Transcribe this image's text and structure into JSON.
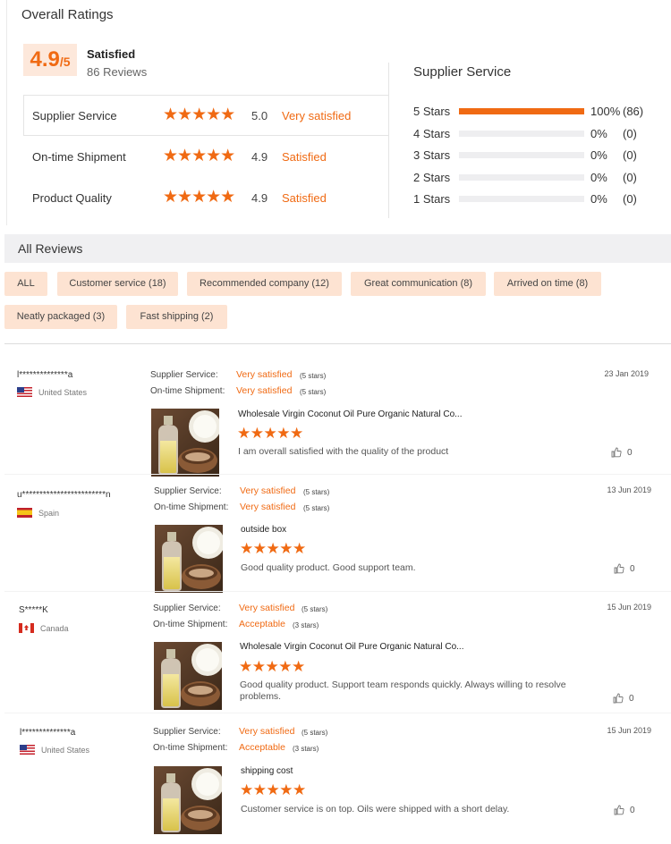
{
  "overall": {
    "title": "Overall Ratings",
    "score": "4.9",
    "score_denominator": "/5",
    "label": "Satisfied",
    "reviews": "86 Reviews"
  },
  "categories": [
    {
      "name": "Supplier Service",
      "stars": "★★★★★",
      "score": "5.0",
      "desc": "Very satisfied"
    },
    {
      "name": "On-time Shipment",
      "stars": "★★★★★",
      "score": "4.9",
      "desc": "Satisfied"
    },
    {
      "name": "Product Quality",
      "stars": "★★★★★",
      "score": "4.9",
      "desc": "Satisfied"
    }
  ],
  "supplier_service": {
    "title": "Supplier Service",
    "rows": [
      {
        "label": "5  Stars",
        "pct": "100%",
        "count": "(86)",
        "fill": 100
      },
      {
        "label": "4  Stars",
        "pct": "0%",
        "count": "(0)",
        "fill": 0
      },
      {
        "label": "3  Stars",
        "pct": "0%",
        "count": "(0)",
        "fill": 0
      },
      {
        "label": "2  Stars",
        "pct": "0%",
        "count": "(0)",
        "fill": 0
      },
      {
        "label": "1  Stars",
        "pct": "0%",
        "count": "(0)",
        "fill": 0
      }
    ]
  },
  "all_reviews": {
    "title": "All Reviews",
    "tags": [
      "ALL",
      "Customer service (18)",
      "Recommended company (12)",
      "Great communication (8)",
      "Arrived on time (8)",
      "Neatly packaged (3)",
      "Fast shipping (2)"
    ]
  },
  "reviews": [
    {
      "user": "l**************a",
      "country": "United States",
      "flag": "us",
      "date": "23 Jan 2019",
      "supplier_label": "Supplier Service:",
      "supplier_value": "Very satisfied",
      "supplier_stars": "(5 stars)",
      "shipment_label": "On-time Shipment:",
      "shipment_value": "Very satisfied",
      "shipment_stars": "(5 stars)",
      "product_title": "Wholesale Virgin Coconut Oil Pure Organic Natural Co...",
      "stars": "★★★★★",
      "comment": "I am overall satisfied with the quality of the product",
      "likes": "0"
    },
    {
      "user": "u************************n",
      "country": "Spain",
      "flag": "es",
      "date": "13 Jun 2019",
      "supplier_label": "Supplier Service:",
      "supplier_value": "Very satisfied",
      "supplier_stars": "(5 stars)",
      "shipment_label": "On-time Shipment:",
      "shipment_value": "Very satisfied",
      "shipment_stars": "(5 stars)",
      "product_title": "outside box",
      "stars": "★★★★★",
      "comment": "Good quality product. Good support team.",
      "likes": "0"
    },
    {
      "user": "S*****K",
      "country": "Canada",
      "flag": "ca",
      "date": "15 Jun 2019",
      "supplier_label": "Supplier Service:",
      "supplier_value": "Very satisfied",
      "supplier_stars": "(5 stars)",
      "shipment_label": "On-time Shipment:",
      "shipment_value": "Acceptable",
      "shipment_stars": "(3 stars)",
      "product_title": "Wholesale Virgin Coconut Oil Pure Organic Natural Co...",
      "stars": "★★★★★",
      "comment": "Good quality product. Support team responds quickly. Always willing to resolve problems.",
      "likes": "0"
    },
    {
      "user": "l**************a",
      "country": "United States",
      "flag": "us",
      "date": "15 Jun 2019",
      "supplier_label": "Supplier Service:",
      "supplier_value": "Very satisfied",
      "supplier_stars": "(5 stars)",
      "shipment_label": "On-time Shipment:",
      "shipment_value": "Acceptable",
      "shipment_stars": "(3 stars)",
      "product_title": "shipping cost",
      "stars": "★★★★★",
      "comment": "Customer service is on top. Oils were shipped with a short delay.",
      "likes": "0"
    }
  ],
  "colors": {
    "accent": "#f06a13",
    "tag_bg": "#fde3d2",
    "score_bg": "#fde8db"
  }
}
